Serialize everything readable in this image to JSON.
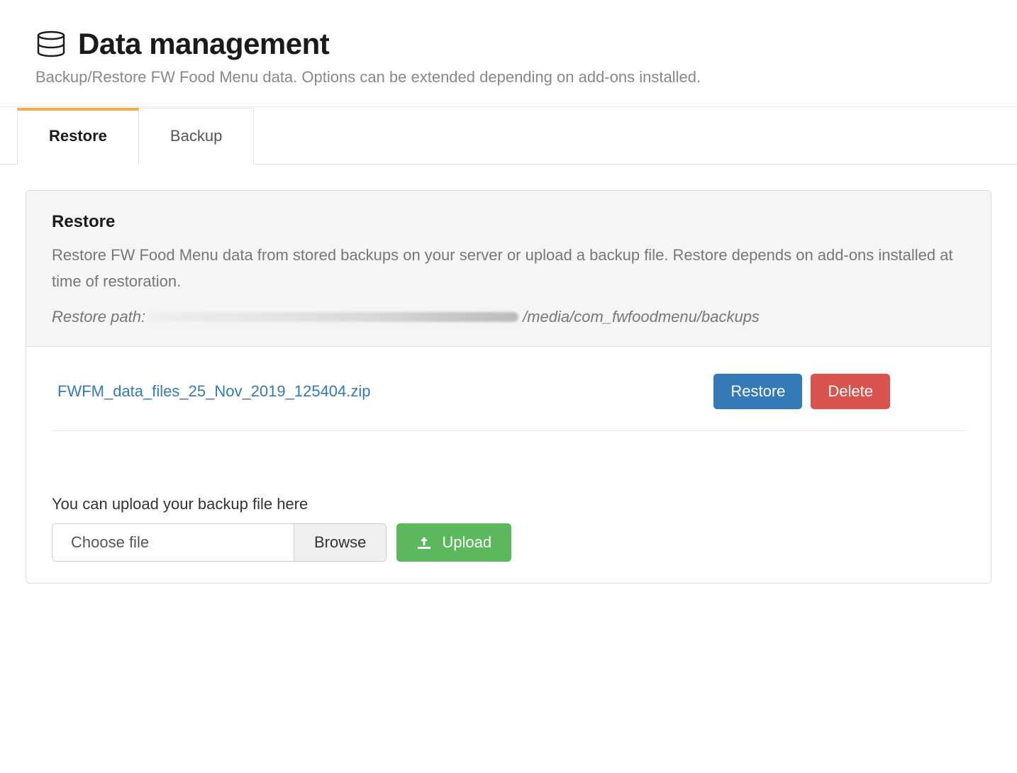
{
  "header": {
    "title": "Data management",
    "subtitle": "Backup/Restore FW Food Menu data. Options can be extended depending on add-ons installed."
  },
  "tabs": {
    "restore": "Restore",
    "backup": "Backup"
  },
  "panel": {
    "title": "Restore",
    "description": "Restore FW Food Menu data from stored backups on your server or upload a backup file. Restore depends on add-ons installed at time of restoration.",
    "restore_path_label": "Restore path:",
    "restore_path_value": "/media/com_fwfoodmenu/backups"
  },
  "backups": {
    "items": [
      {
        "filename": "FWFM_data_files_25_Nov_2019_125404.zip"
      }
    ],
    "actions": {
      "restore": "Restore",
      "delete": "Delete"
    }
  },
  "upload": {
    "label": "You can upload your backup file here",
    "choose_file": "Choose file",
    "browse": "Browse",
    "upload_button": "Upload"
  }
}
